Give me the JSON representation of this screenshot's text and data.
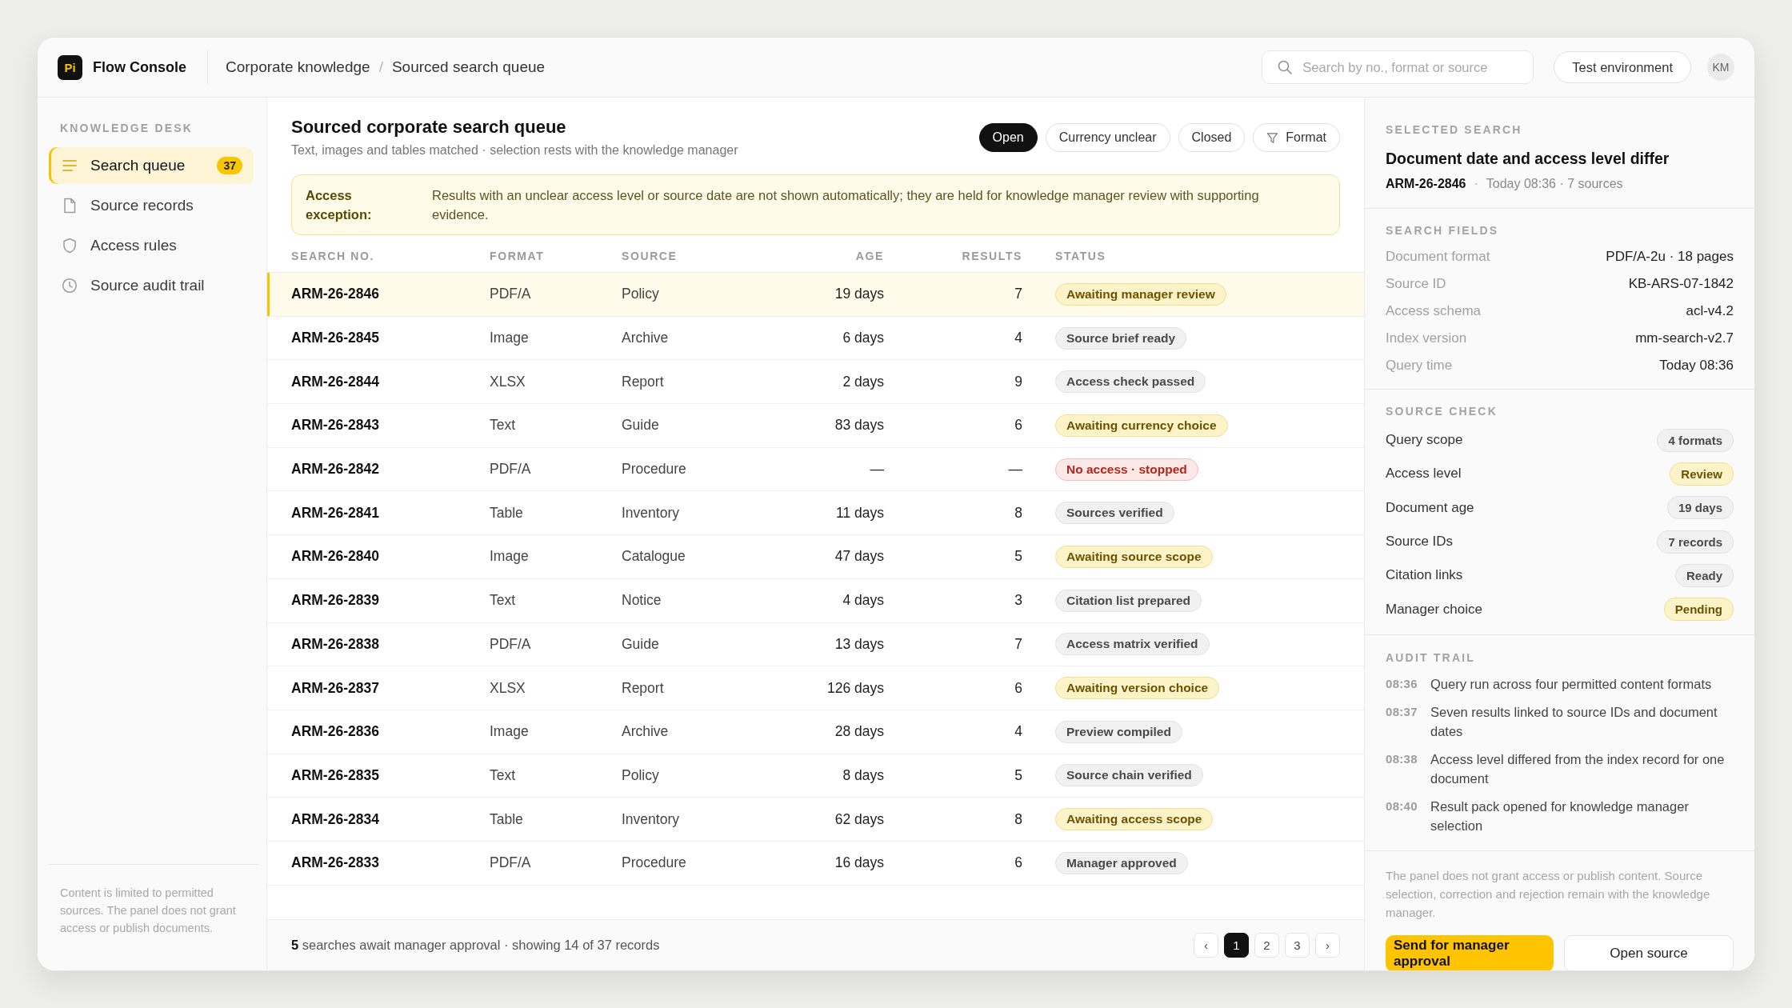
{
  "app": {
    "logo": "Pi",
    "name": "Flow Console"
  },
  "breadcrumb": {
    "separator": "/",
    "items": [
      "Corporate knowledge",
      "Sourced search queue"
    ]
  },
  "search": {
    "placeholder": "Search by no., format or source"
  },
  "environment": "Test environment",
  "user": {
    "initials": "KM"
  },
  "sidebar": {
    "heading": "KNOWLEDGE DESK",
    "items": [
      {
        "kind": "queue",
        "label": "Search queue",
        "count": "37",
        "selected": true
      },
      {
        "kind": "records",
        "label": "Source records",
        "selected": false
      },
      {
        "kind": "rules",
        "label": "Access rules",
        "selected": false
      },
      {
        "kind": "trail",
        "label": "Source audit trail",
        "selected": false
      }
    ],
    "note": "Content is limited to permitted sources. The panel does not grant access or publish documents."
  },
  "queue": {
    "title": "Sourced corporate search queue",
    "subtitle": "Text, images and tables matched · selection rests with the knowledge manager",
    "filters": [
      {
        "kind": "toggle",
        "label": "Open",
        "selected": true
      },
      {
        "kind": "toggle",
        "label": "Currency unclear",
        "selected": false
      },
      {
        "kind": "toggle",
        "label": "Closed",
        "selected": false
      },
      {
        "kind": "menu",
        "label": "Format",
        "selected": false
      }
    ],
    "alert": {
      "label": "Access exception:",
      "text": "Results with an unclear access level or source date are not shown automatically; they are held for knowledge manager review with supporting evidence."
    }
  },
  "table": {
    "columns": [
      "SEARCH NO.",
      "FORMAT",
      "SOURCE",
      "AGE",
      "RESULTS",
      "STATUS"
    ],
    "rows": [
      {
        "search_no": "ARM-26-2846",
        "format": "PDF/A",
        "source": "Policy",
        "age": "19 days",
        "results": "7",
        "status": {
          "label": "Awaiting manager review",
          "kind": "waiting"
        },
        "selected": true
      },
      {
        "search_no": "ARM-26-2845",
        "format": "Image",
        "source": "Archive",
        "age": "6 days",
        "results": "4",
        "status": {
          "label": "Source brief ready",
          "kind": "done"
        },
        "selected": false
      },
      {
        "search_no": "ARM-26-2844",
        "format": "XLSX",
        "source": "Report",
        "age": "2 days",
        "results": "9",
        "status": {
          "label": "Access check passed",
          "kind": "done"
        },
        "selected": false
      },
      {
        "search_no": "ARM-26-2843",
        "format": "Text",
        "source": "Guide",
        "age": "83 days",
        "results": "6",
        "status": {
          "label": "Awaiting currency choice",
          "kind": "waiting"
        },
        "selected": false
      },
      {
        "search_no": "ARM-26-2842",
        "format": "PDF/A",
        "source": "Procedure",
        "age": "—",
        "results": "—",
        "status": {
          "label": "No access · stopped",
          "kind": "stopped"
        },
        "selected": false
      },
      {
        "search_no": "ARM-26-2841",
        "format": "Table",
        "source": "Inventory",
        "age": "11 days",
        "results": "8",
        "status": {
          "label": "Sources verified",
          "kind": "done"
        },
        "selected": false
      },
      {
        "search_no": "ARM-26-2840",
        "format": "Image",
        "source": "Catalogue",
        "age": "47 days",
        "results": "5",
        "status": {
          "label": "Awaiting source scope",
          "kind": "waiting"
        },
        "selected": false
      },
      {
        "search_no": "ARM-26-2839",
        "format": "Text",
        "source": "Notice",
        "age": "4 days",
        "results": "3",
        "status": {
          "label": "Citation list prepared",
          "kind": "done"
        },
        "selected": false
      },
      {
        "search_no": "ARM-26-2838",
        "format": "PDF/A",
        "source": "Guide",
        "age": "13 days",
        "results": "7",
        "status": {
          "label": "Access matrix verified",
          "kind": "done"
        },
        "selected": false
      },
      {
        "search_no": "ARM-26-2837",
        "format": "XLSX",
        "source": "Report",
        "age": "126 days",
        "results": "6",
        "status": {
          "label": "Awaiting version choice",
          "kind": "waiting"
        },
        "selected": false
      },
      {
        "search_no": "ARM-26-2836",
        "format": "Image",
        "source": "Archive",
        "age": "28 days",
        "results": "4",
        "status": {
          "label": "Preview compiled",
          "kind": "done"
        },
        "selected": false
      },
      {
        "search_no": "ARM-26-2835",
        "format": "Text",
        "source": "Policy",
        "age": "8 days",
        "results": "5",
        "status": {
          "label": "Source chain verified",
          "kind": "done"
        },
        "selected": false
      },
      {
        "search_no": "ARM-26-2834",
        "format": "Table",
        "source": "Inventory",
        "age": "62 days",
        "results": "8",
        "status": {
          "label": "Awaiting access scope",
          "kind": "waiting"
        },
        "selected": false
      },
      {
        "search_no": "ARM-26-2833",
        "format": "PDF/A",
        "source": "Procedure",
        "age": "16 days",
        "results": "6",
        "status": {
          "label": "Manager approved",
          "kind": "done"
        },
        "selected": false
      }
    ]
  },
  "footer": {
    "summary": "**5** searches await manager approval · showing 14 of 37 records",
    "pagination": {
      "prev": "‹",
      "next": "›",
      "pages": [
        {
          "label": "1",
          "selected": true
        },
        {
          "label": "2",
          "selected": false
        },
        {
          "label": "3",
          "selected": false
        }
      ]
    }
  },
  "details": {
    "heading": "SELECTED SEARCH",
    "title": "Document date and access level differ",
    "id": "ARM-26-2846",
    "separator": "·",
    "meta": "Today 08:36 · 7 sources",
    "fields": {
      "heading": "SEARCH FIELDS",
      "items": [
        {
          "label": "Document format",
          "value": "PDF/A-2u · 18 pages"
        },
        {
          "label": "Source ID",
          "value": "KB-ARS-07-1842"
        },
        {
          "label": "Access schema",
          "value": "acl-v4.2"
        },
        {
          "label": "Index version",
          "value": "mm-search-v2.7"
        },
        {
          "label": "Query time",
          "value": "Today 08:36"
        }
      ]
    },
    "checks": {
      "heading": "SOURCE CHECK",
      "items": [
        {
          "label": "Query scope",
          "value": "4 formats",
          "kind": "done"
        },
        {
          "label": "Access level",
          "value": "Review",
          "kind": "waiting"
        },
        {
          "label": "Document age",
          "value": "19 days",
          "kind": "done"
        },
        {
          "label": "Source IDs",
          "value": "7 records",
          "kind": "done"
        },
        {
          "label": "Citation links",
          "value": "Ready",
          "kind": "done"
        },
        {
          "label": "Manager choice",
          "value": "Pending",
          "kind": "waiting"
        }
      ]
    },
    "audit": {
      "heading": "AUDIT TRAIL",
      "entries": [
        {
          "time": "08:36",
          "text": "Query run across four permitted content formats"
        },
        {
          "time": "08:37",
          "text": "Seven results linked to source IDs and document dates"
        },
        {
          "time": "08:38",
          "text": "Access level differed from the index record for one document"
        },
        {
          "time": "08:40",
          "text": "Result pack opened for knowledge manager selection"
        }
      ]
    },
    "note": "The panel does not grant access or publish content. Source selection, correction and rejection remain with the knowledge manager.",
    "actions": [
      {
        "kind": "primary",
        "label": "Send for manager approval"
      },
      {
        "kind": "secondary",
        "label": "Open source"
      }
    ]
  }
}
